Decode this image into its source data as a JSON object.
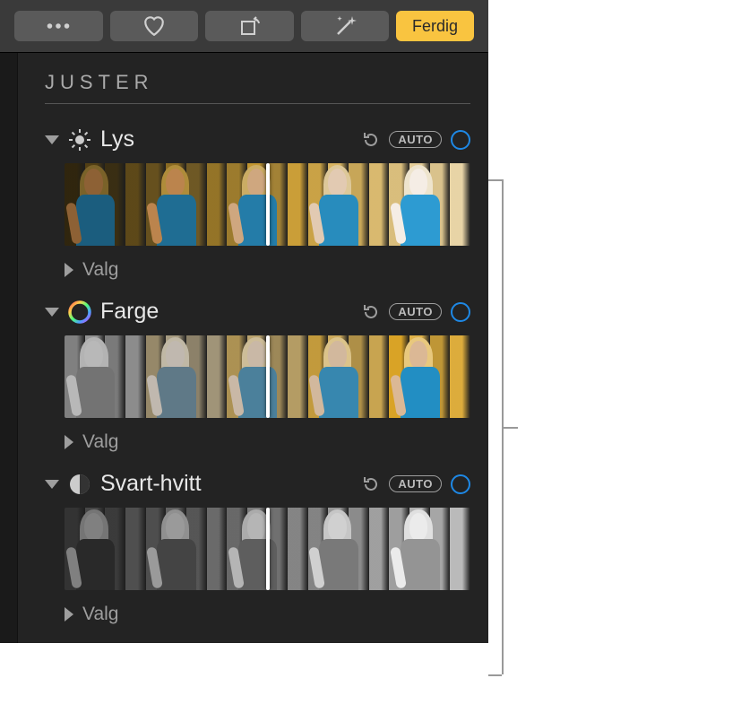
{
  "toolbar": {
    "done_label": "Ferdig"
  },
  "panel": {
    "title": "JUSTER"
  },
  "sections": [
    {
      "label": "Lys",
      "auto_label": "AUTO",
      "options_label": "Valg",
      "icon": "light",
      "expanded": true,
      "strip_type": "light"
    },
    {
      "label": "Farge",
      "auto_label": "AUTO",
      "options_label": "Valg",
      "icon": "color",
      "expanded": true,
      "strip_type": "color"
    },
    {
      "label": "Svart-hvitt",
      "auto_label": "AUTO",
      "options_label": "Valg",
      "icon": "bw",
      "expanded": true,
      "strip_type": "bw"
    }
  ]
}
